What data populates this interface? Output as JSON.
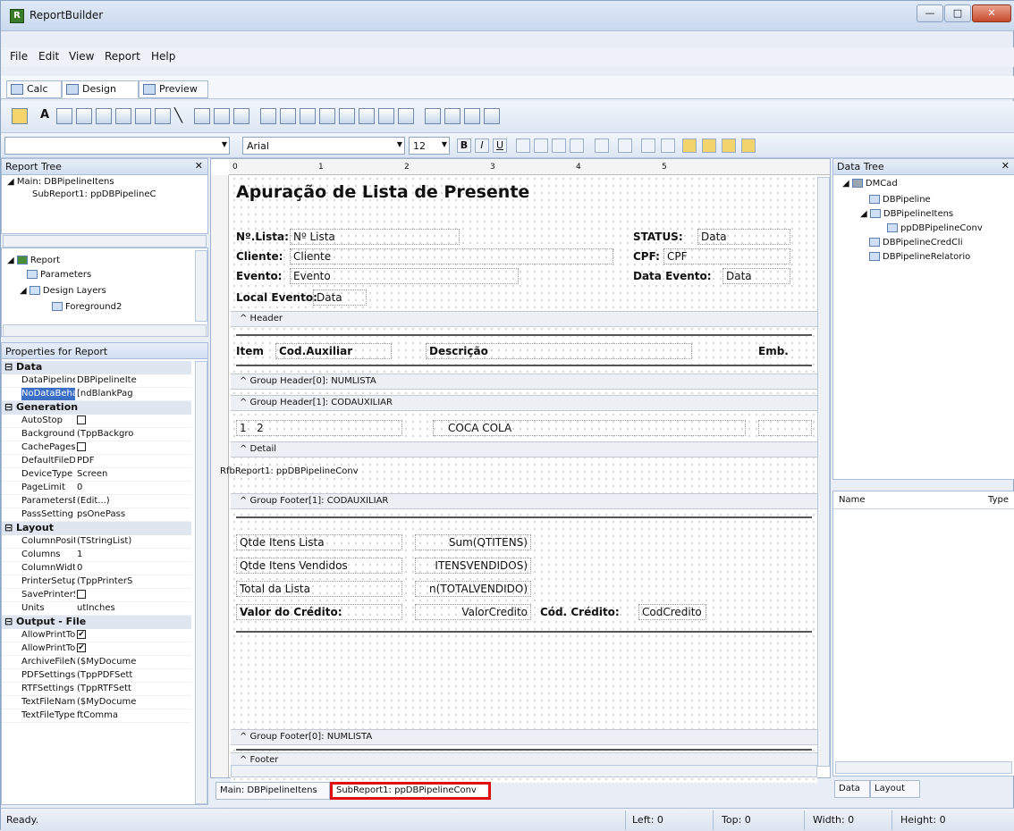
{
  "window": {
    "title": "ReportBuilder"
  },
  "menu": [
    "File",
    "Edit",
    "View",
    "Report",
    "Help"
  ],
  "mode_tabs": [
    "Calc",
    "Design",
    "Preview"
  ],
  "font": {
    "name": "Arial",
    "size": "12"
  },
  "report_tree": {
    "title": "Report Tree",
    "items": [
      "Main: DBPipelineItens",
      "SubReport1: ppDBPipelineC"
    ]
  },
  "layer_tree": [
    "Report",
    "Parameters",
    "Design Layers",
    "Foreground2"
  ],
  "properties": {
    "title": "Properties for Report",
    "categories": [
      {
        "name": "Data",
        "rows": [
          [
            "DataPipeline",
            "DBPipelineIte"
          ],
          [
            "NoDataBehav",
            "[ndBlankPag"
          ]
        ]
      },
      {
        "name": "Generation",
        "rows": [
          [
            "AutoStop",
            ""
          ],
          [
            "BackgroundPr",
            "(TppBackgro"
          ],
          [
            "CachePages",
            ""
          ],
          [
            "DefaultFileDe",
            "PDF"
          ],
          [
            "DeviceType",
            "Screen"
          ],
          [
            "PageLimit",
            "0"
          ],
          [
            "ParametersEd",
            "(Edit...)"
          ],
          [
            "PassSetting",
            "psOnePass"
          ]
        ]
      },
      {
        "name": "Layout",
        "rows": [
          [
            "ColumnPositio",
            "(TStringList)"
          ],
          [
            "Columns",
            "1"
          ],
          [
            "ColumnWidth",
            "0"
          ],
          [
            "PrinterSetup",
            "(TppPrinterS"
          ],
          [
            "SavePrinterSe",
            ""
          ],
          [
            "Units",
            "utInches"
          ]
        ]
      },
      {
        "name": "Output - File",
        "rows": [
          [
            "AllowPrintToA",
            "✔"
          ],
          [
            "AllowPrintToFi",
            "✔"
          ],
          [
            "ArchiveFileNa",
            "($MyDocume"
          ],
          [
            "PDFSettings",
            "(TppPDFSett"
          ],
          [
            "RTFSettings",
            "(TppRTFSett"
          ],
          [
            "TextFileName",
            "($MyDocume"
          ],
          [
            "TextFileType",
            "ftComma"
          ]
        ]
      }
    ]
  },
  "report": {
    "title": "Apuração de Lista de Presente",
    "lbl_nlista": "Nº.Lista:",
    "fld_nlista": "Nº Lista",
    "lbl_status": "STATUS:",
    "fld_status": "Data",
    "lbl_cliente": "Cliente:",
    "fld_cliente": "Cliente",
    "lbl_cpf": "CPF:",
    "fld_cpf": "CPF",
    "lbl_evento": "Evento:",
    "fld_evento": "Evento",
    "lbl_dataevento": "Data Evento:",
    "fld_dataevento": "Data",
    "lbl_local": "Local Evento:",
    "fld_local": "Data",
    "band_header": "^ Header",
    "col_item": "Item",
    "col_cod": "Cod.Auxiliar",
    "col_desc": "Descrição",
    "col_emb": "Emb.",
    "band_gh0": "^ Group Header[0]: NUMLISTA",
    "band_gh1": "^ Group Header[1]: CODAUXILIAR",
    "fld_item": "1",
    "fld_cod": "2",
    "fld_desc": "COCA COLA",
    "band_detail": "^ Detail",
    "subreport": "RfbReport1: ppDBPipelineConv",
    "band_gf1": "^ Group Footer[1]: CODAUXILIAR",
    "lbl_qtde_itens": "Qtde Itens Lista",
    "fld_qtde_itens": "Sum(QTITENS)",
    "lbl_qtde_vend": "Qtde Itens Vendidos",
    "fld_qtde_vend": "ITENSVENDIDOS)",
    "lbl_total": "Total da Lista",
    "fld_total": "n(TOTALVENDIDO)",
    "lbl_credito": "Valor do Crédito:",
    "fld_credito": "ValorCredito",
    "lbl_cod_credito": "Cód. Crédito:",
    "fld_cod_credito": "CodCredito",
    "band_gf0": "^ Group Footer[0]: NUMLISTA",
    "band_footer": "^ Footer"
  },
  "ruler_marks": [
    "0",
    "1",
    "2",
    "3",
    "4",
    "5"
  ],
  "bottom_tabs": [
    "Main: DBPipelineItens",
    "SubReport1: ppDBPipelineConv"
  ],
  "data_tree": {
    "title": "Data Tree",
    "items": [
      "DMCad",
      "DBPipeline",
      "DBPipelineItens",
      "ppDBPipelineConv",
      "DBPipelineCredCli",
      "DBPipelineRelatorio"
    ],
    "col_name": "Name",
    "col_type": "Type",
    "tabs": [
      "Data",
      "Layout"
    ]
  },
  "status": {
    "text": "Ready.",
    "left": "Left: 0",
    "top": "Top: 0",
    "width": "Width: 0",
    "height": "Height: 0"
  },
  "colors": {
    "highlight_box": "#e01010",
    "selection": "#3b6fc6"
  }
}
